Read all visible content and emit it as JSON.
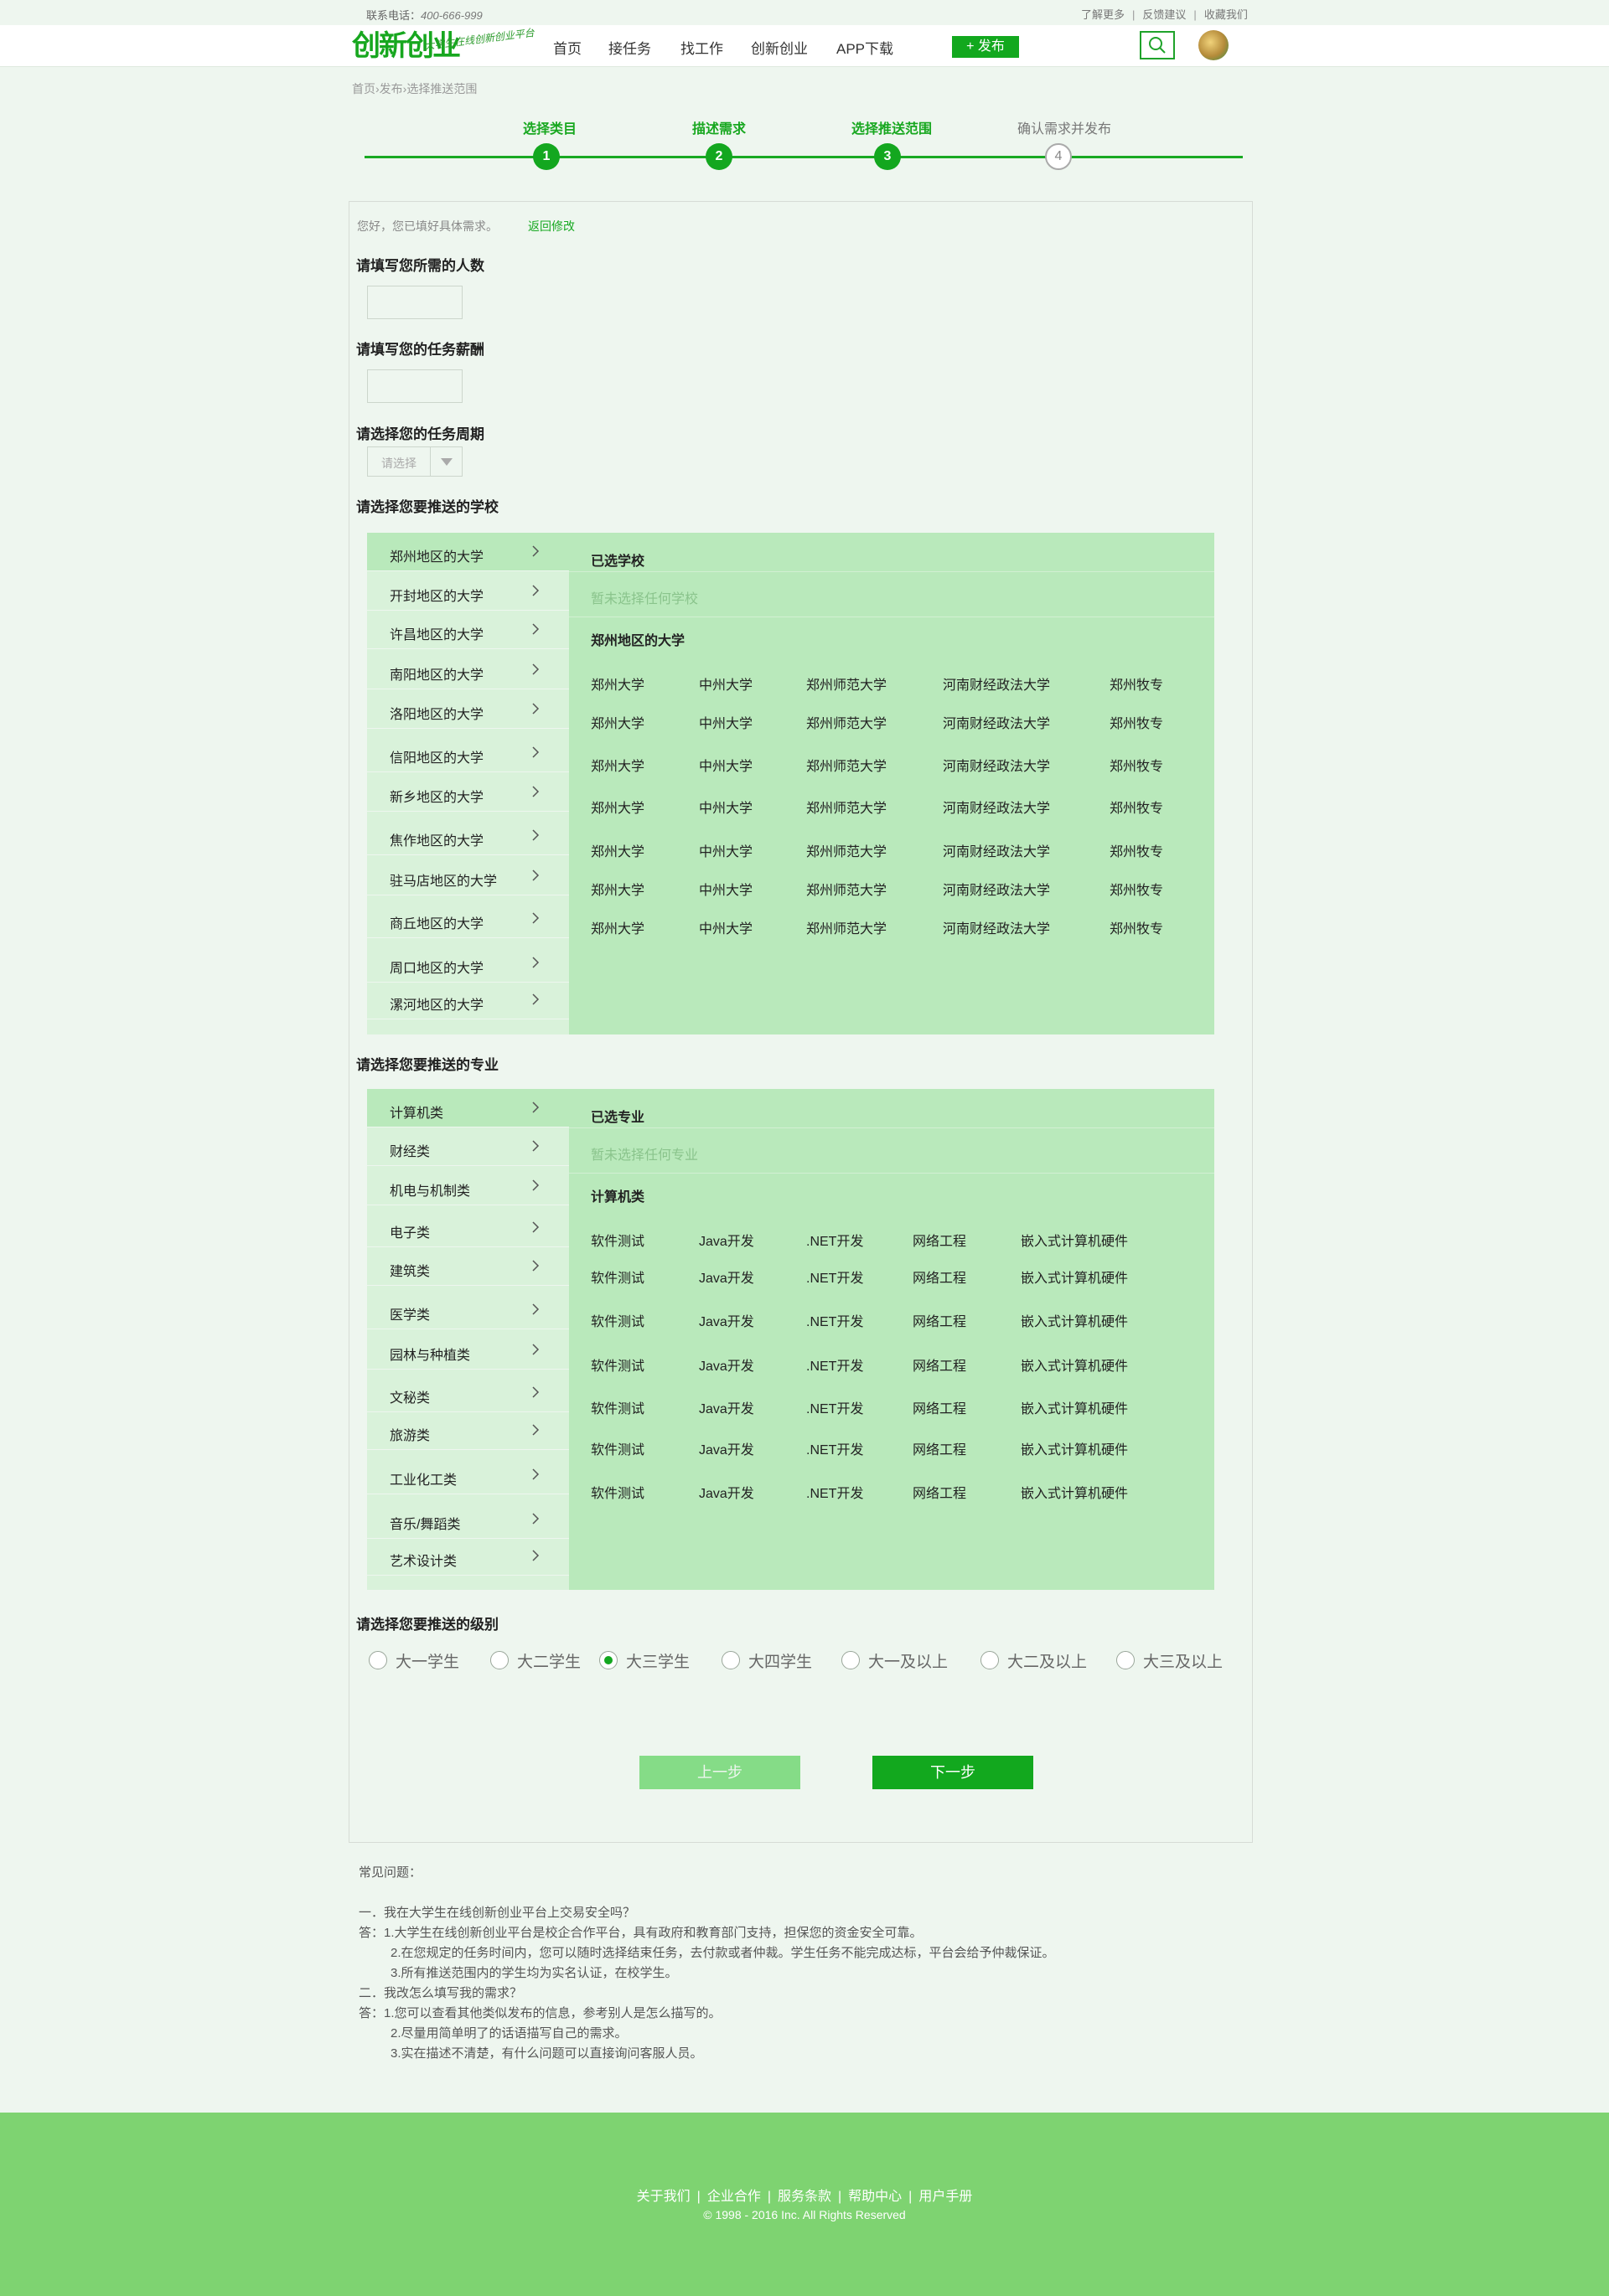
{
  "topbar": {
    "phone_label": "联系电话：",
    "phone_number": "400-666-999",
    "links": [
      "了解更多",
      "反馈建议",
      "收藏我们"
    ]
  },
  "header": {
    "logo_text": "创新创业",
    "logo_slogan": "大学生在线创新创业平台",
    "nav": [
      "首页",
      "接任务",
      "找工作",
      "创新创业",
      "APP下载"
    ],
    "publish_label": "+ 发布"
  },
  "breadcrumb": "首页›发布›选择推送范围",
  "steps": [
    {
      "label": "选择类目",
      "num": "1",
      "done": true
    },
    {
      "label": "描述需求",
      "num": "2",
      "done": true
    },
    {
      "label": "选择推送范围",
      "num": "3",
      "done": true
    },
    {
      "label": "确认需求并发布",
      "num": "4",
      "done": false
    }
  ],
  "form": {
    "filled_hint": "您好，您已填好具体需求。",
    "back_edit": "返回修改",
    "q_people": "请填写您所需的人数",
    "q_salary": "请填写您的任务薪酬",
    "q_period": "请选择您的任务周期",
    "period_placeholder": "请选择",
    "q_school": "请选择您要推送的学校",
    "q_major": "请选择您要推送的专业",
    "q_level": "请选择您要推送的级别",
    "prev_label": "上一步",
    "next_label": "下一步"
  },
  "schools": {
    "regions": [
      "郑州地区的大学",
      "开封地区的大学",
      "许昌地区的大学",
      "南阳地区的大学",
      "洛阳地区的大学",
      "信阳地区的大学",
      "新乡地区的大学",
      "焦作地区的大学",
      "驻马店地区的大学",
      "商丘地区的大学",
      "周口地区的大学",
      "漯河地区的大学"
    ],
    "selected_title": "已选学校",
    "none_selected": "暂未选择任何学校",
    "current_region": "郑州地区的大学",
    "grid": [
      [
        "郑州大学",
        "中州大学",
        "郑州师范大学",
        "河南财经政法大学",
        "郑州牧专"
      ],
      [
        "郑州大学",
        "中州大学",
        "郑州师范大学",
        "河南财经政法大学",
        "郑州牧专"
      ],
      [
        "郑州大学",
        "中州大学",
        "郑州师范大学",
        "河南财经政法大学",
        "郑州牧专"
      ],
      [
        "郑州大学",
        "中州大学",
        "郑州师范大学",
        "河南财经政法大学",
        "郑州牧专"
      ],
      [
        "郑州大学",
        "中州大学",
        "郑州师范大学",
        "河南财经政法大学",
        "郑州牧专"
      ],
      [
        "郑州大学",
        "中州大学",
        "郑州师范大学",
        "河南财经政法大学",
        "郑州牧专"
      ],
      [
        "郑州大学",
        "中州大学",
        "郑州师范大学",
        "河南财经政法大学",
        "郑州牧专"
      ]
    ]
  },
  "majors": {
    "categories": [
      "计算机类",
      "财经类",
      "机电与机制类",
      "电子类",
      "建筑类",
      "医学类",
      "园林与种植类",
      "文秘类",
      "旅游类",
      "工业化工类",
      "音乐/舞蹈类",
      "艺术设计类"
    ],
    "selected_title": "已选专业",
    "none_selected": "暂未选择任何专业",
    "current_category": "计算机类",
    "grid": [
      [
        "软件测试",
        "Java开发",
        ".NET开发",
        "网络工程",
        "嵌入式计算机硬件"
      ],
      [
        "软件测试",
        "Java开发",
        ".NET开发",
        "网络工程",
        "嵌入式计算机硬件"
      ],
      [
        "软件测试",
        "Java开发",
        ".NET开发",
        "网络工程",
        "嵌入式计算机硬件"
      ],
      [
        "软件测试",
        "Java开发",
        ".NET开发",
        "网络工程",
        "嵌入式计算机硬件"
      ],
      [
        "软件测试",
        "Java开发",
        ".NET开发",
        "网络工程",
        "嵌入式计算机硬件"
      ],
      [
        "软件测试",
        "Java开发",
        ".NET开发",
        "网络工程",
        "嵌入式计算机硬件"
      ],
      [
        "软件测试",
        "Java开发",
        ".NET开发",
        "网络工程",
        "嵌入式计算机硬件"
      ]
    ]
  },
  "levels": {
    "options": [
      "大一学生",
      "大二学生",
      "大三学生",
      "大四学生",
      "大一及以上",
      "大二及以上",
      "大三及以上"
    ],
    "selected": "大三学生"
  },
  "faq": {
    "title": "常见问题：",
    "q1": "一．我在大学生在线创新创业平台上交易安全吗？",
    "a1": [
      "答：1.大学生在线创新创业平台是校企合作平台，具有政府和教育部门支持，担保您的资金安全可靠。",
      "2.在您规定的任务时间内，您可以随时选择结束任务，去付款或者仲裁。学生任务不能完成达标，平台会给予仲裁保证。",
      "3.所有推送范围内的学生均为实名认证，在校学生。"
    ],
    "q2": "二．我改怎么填写我的需求？",
    "a2": [
      "答：1.您可以查看其他类似发布的信息，参考别人是怎么描写的。",
      "2.尽量用简单明了的话语描写自己的需求。",
      "3.实在描述不清楚，有什么问题可以直接询问客服人员。"
    ]
  },
  "footer": {
    "links": [
      "关于我们",
      "企业合作",
      "服务条款",
      "帮助中心",
      "用户手册"
    ],
    "copyright": "© 1998 - 2016  Inc. All Rights Reserved"
  },
  "colors": {
    "accent": "#13a71f",
    "panel_green": "#b9e9bb",
    "footer_green": "#7ed371"
  }
}
